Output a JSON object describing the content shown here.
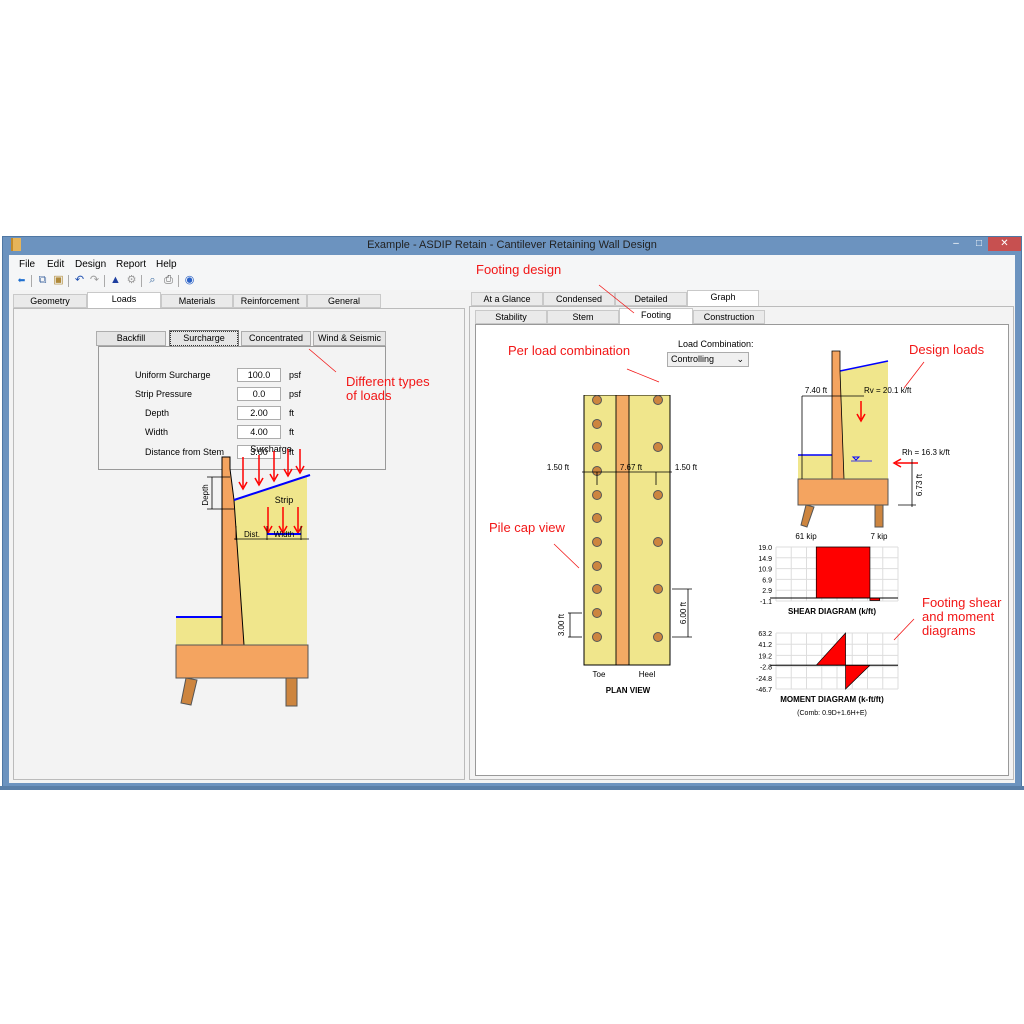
{
  "window": {
    "title": "Example - ASDIP Retain - Cantilever Retaining Wall Design",
    "controls": {
      "minimize": "–",
      "maximize": "□",
      "close": "✕"
    }
  },
  "menu": [
    "File",
    "Edit",
    "Design",
    "Report",
    "Help"
  ],
  "toolbar": [
    "pm-arrow-icon",
    "copy-icon",
    "paste-icon",
    "undo-icon",
    "redo-icon",
    "design-icon",
    "settings-icon",
    "preview-icon",
    "print-icon",
    "help-icon"
  ],
  "left_tabs": [
    {
      "label": "Geometry",
      "active": false
    },
    {
      "label": "Loads",
      "active": true
    },
    {
      "label": "Materials",
      "active": false
    },
    {
      "label": "Reinforcement",
      "active": false
    },
    {
      "label": "General",
      "active": false
    }
  ],
  "load_buttons": [
    {
      "label": "Backfill",
      "selected": false
    },
    {
      "label": "Surcharge",
      "selected": true
    },
    {
      "label": "Concentrated",
      "selected": false
    },
    {
      "label": "Wind & Seismic",
      "selected": false
    }
  ],
  "surcharge_form": [
    {
      "label": "Uniform Surcharge",
      "value": "100.0",
      "unit": "psf",
      "indent": false
    },
    {
      "label": "Strip Pressure",
      "value": "0.0",
      "unit": "psf",
      "indent": false
    },
    {
      "label": "Depth",
      "value": "2.00",
      "unit": "ft",
      "indent": true
    },
    {
      "label": "Width",
      "value": "4.00",
      "unit": "ft",
      "indent": true
    },
    {
      "label": "Distance from Stem",
      "value": "3.00",
      "unit": "ft",
      "indent": true
    }
  ],
  "left_diagram": {
    "surcharge_label": "Surcharge",
    "strip_label": "Strip",
    "depth_label": "Depth",
    "dist_label": "Dist.",
    "width_label": "Width"
  },
  "right_tabs": [
    {
      "label": "At a Glance",
      "active": false
    },
    {
      "label": "Condensed",
      "active": false
    },
    {
      "label": "Detailed",
      "active": false
    },
    {
      "label": "Graph",
      "active": true
    }
  ],
  "graph_subtabs": [
    {
      "label": "Stability",
      "active": false
    },
    {
      "label": "Stem",
      "active": false
    },
    {
      "label": "Footing",
      "active": true
    },
    {
      "label": "Construction",
      "active": false
    }
  ],
  "load_combination": {
    "label": "Load Combination:",
    "value": "Controlling"
  },
  "plan_view": {
    "title": "PLAN VIEW",
    "left_edge": "1.50 ft",
    "width": "7.67 ft",
    "right_edge": "1.50 ft",
    "toe_spacing": "3.00 ft",
    "heel_spacing": "6.00 ft",
    "toe_label": "Toe",
    "heel_label": "Heel"
  },
  "section_view": {
    "rv_distance": "7.40 ft",
    "rv": "Rv = 20.1 k/ft",
    "rh": "Rh = 16.3 k/ft",
    "rh_height": "6.73 ft",
    "toe_pile": "61 kip",
    "heel_pile": "7 kip"
  },
  "chart_data": [
    {
      "type": "area",
      "title": "SHEAR DIAGRAM (k/ft)",
      "ylabel": "",
      "y_ticks": [
        "19.0",
        "14.9",
        "10.9",
        "6.9",
        "2.9",
        "-1.1"
      ],
      "ylim": [
        -1.1,
        19.0
      ],
      "x": [
        0.0,
        0.33,
        0.33,
        0.77,
        0.77,
        0.85,
        0.85,
        1.0
      ],
      "values": [
        0,
        0,
        19.0,
        19.0,
        -0.9,
        -0.9,
        0,
        0
      ],
      "grid": true
    },
    {
      "type": "area",
      "title": "MOMENT DIAGRAM (k-ft/ft)",
      "subtitle": "(Comb: 0.9D+1.6H+E)",
      "y_ticks": [
        "63.2",
        "41.2",
        "19.2",
        "-2.8",
        "-24.8",
        "-46.7"
      ],
      "ylim": [
        -46.7,
        63.2
      ],
      "x": [
        0.0,
        0.33,
        0.57,
        0.57,
        0.77,
        0.85,
        1.0
      ],
      "values": [
        0,
        0,
        63.2,
        -46.7,
        0,
        0,
        0
      ],
      "grid": true
    }
  ],
  "annotations": [
    {
      "id": "footing-design",
      "text": "Footing design"
    },
    {
      "id": "per-load-combination",
      "text": "Per load combination"
    },
    {
      "id": "design-loads",
      "text": "Design loads"
    },
    {
      "id": "different-loads",
      "text": "Different types\nof loads"
    },
    {
      "id": "pile-cap-view",
      "text": "Pile cap view"
    },
    {
      "id": "footing-diagrams",
      "text": "Footing shear\nand moment\ndiagrams"
    }
  ],
  "colors": {
    "annotation": "#f21616",
    "soil": "#f0e68c",
    "concrete": "#f4a460",
    "pile": "#cd853f",
    "load": "#ff0000",
    "grade": "#0000ff"
  }
}
